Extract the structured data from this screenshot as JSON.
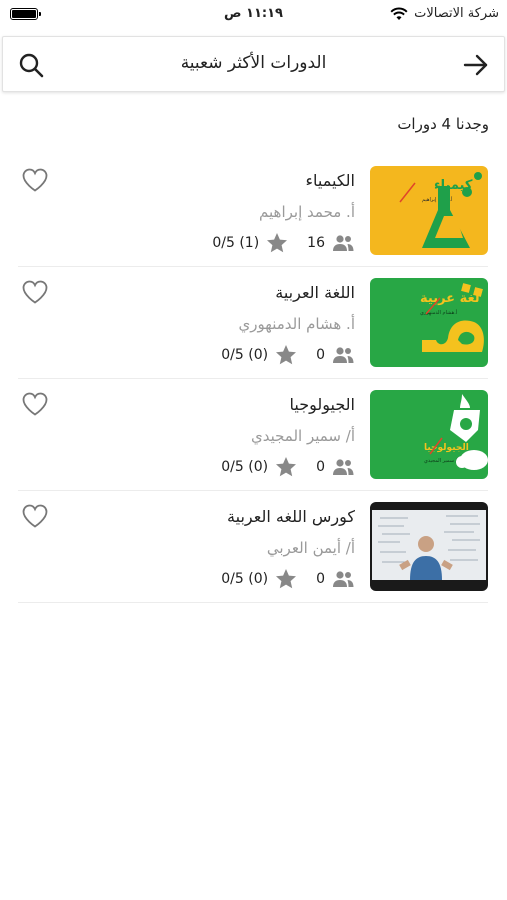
{
  "status_bar": {
    "carrier": "شركة الاتصالات",
    "time": "١١:١٩ ص"
  },
  "header": {
    "title": "الدورات الأكثر شعبية",
    "back_icon": "arrow-right-icon",
    "search_icon": "search-icon"
  },
  "results": {
    "count_text": "وجدنا 4 دورات"
  },
  "courses": [
    {
      "title": "الكيمياء",
      "teacher": "أ. محمد إبراهيم",
      "students": "16",
      "rating": "0/5 (1)",
      "thumb_text": "كيمياء",
      "thumb_sub": "أ.محمد إبراهيم",
      "thumb_icon": "flask-icon"
    },
    {
      "title": "اللغة العربية",
      "teacher": "أ. هشام الدمنهوري",
      "students": "0",
      "rating": "0/5 (0)",
      "thumb_text": "لغة عربية",
      "thumb_sub": "أ.هشام الدمنهوري",
      "thumb_icon": "arabic-letter-icon"
    },
    {
      "title": "الجيولوجيا",
      "teacher": "أ/ سمير المجيدي",
      "students": "0",
      "rating": "0/5 (0)",
      "thumb_text": "الجيولوجيا",
      "thumb_sub": "أ/ سمير المجيدي",
      "thumb_icon": "geology-icon"
    },
    {
      "title": "كورس اللغه العربية",
      "teacher": "أ/ أيمن العربي",
      "students": "0",
      "rating": "0/5 (0)",
      "thumb_icon": "video-lecture-thumbnail"
    }
  ],
  "colors": {
    "chem_bg": "#f4b71e",
    "chem_accent": "#1fa04a",
    "green_bg": "#28a745",
    "yellow_accent": "#f4c21e",
    "text": "#222222",
    "muted": "#9a9a9a",
    "icon_gray": "#888888"
  }
}
